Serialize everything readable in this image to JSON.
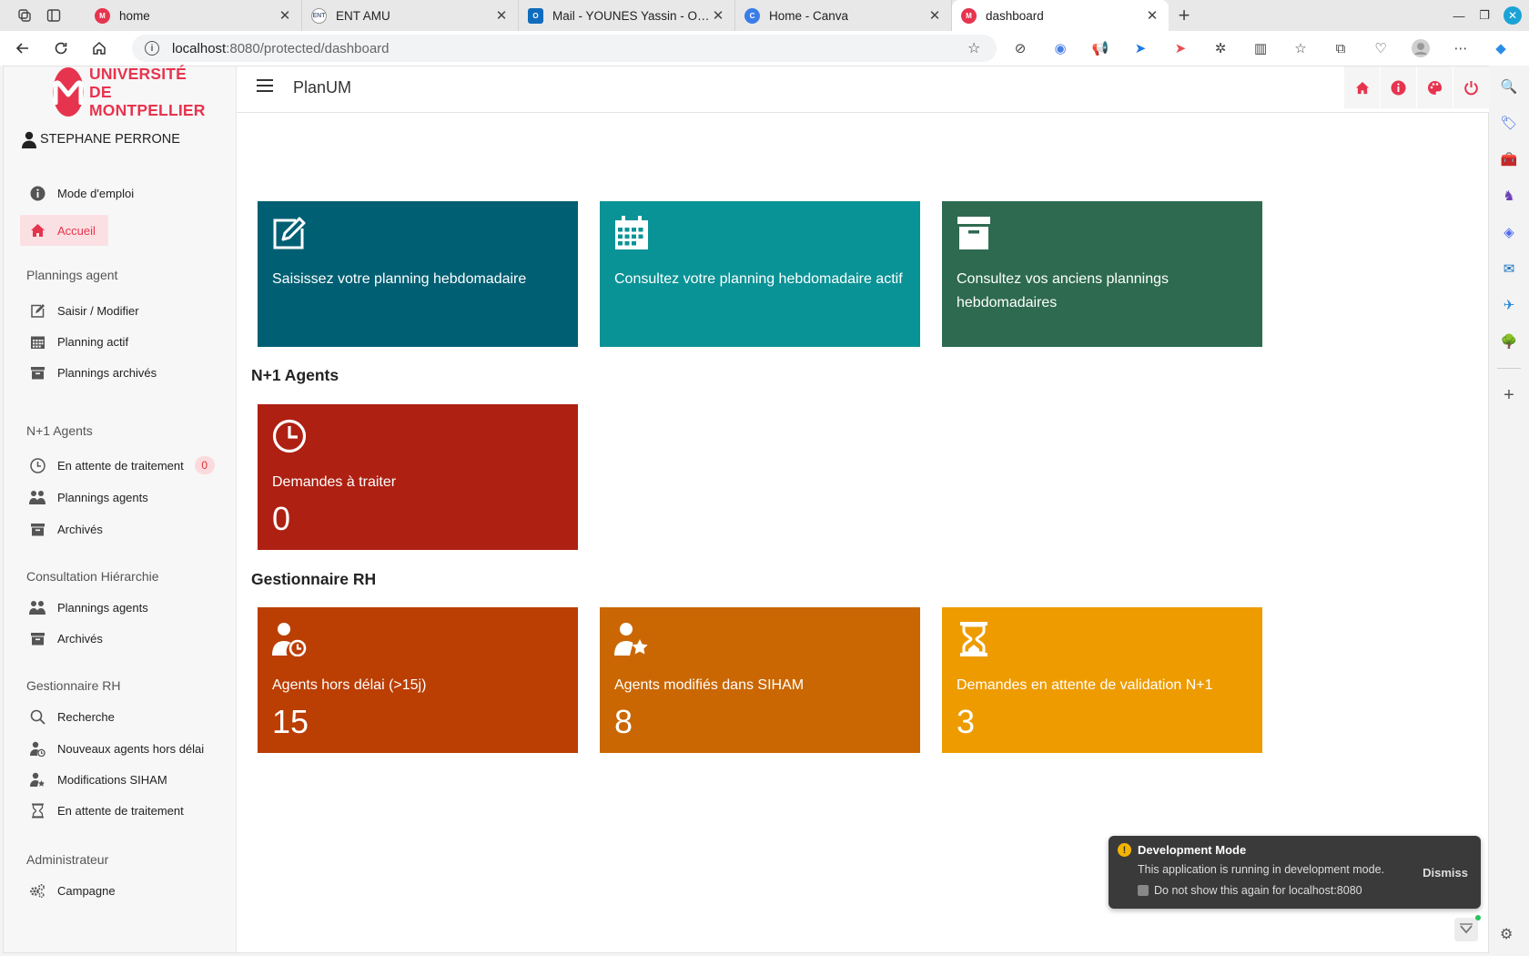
{
  "browser": {
    "tabs": [
      {
        "title": "home",
        "favicon_color": "#e7344e"
      },
      {
        "title": "ENT AMU",
        "favicon_color": "#5a6c8a"
      },
      {
        "title": "Mail - YOUNES Yassin - Outlook",
        "favicon_color": "#0f6cbd"
      },
      {
        "title": "Home - Canva",
        "favicon_color": "#3b7de8"
      },
      {
        "title": "dashboard",
        "favicon_color": "#e7344e"
      }
    ],
    "url_host": "localhost",
    "url_rest": ":8080/protected/dashboard"
  },
  "sidebar": {
    "logo_text_line1": "UNIVERSITÉ DE",
    "logo_text_line2": "MONTPELLIER",
    "user_name": "STEPHANE PERRONE",
    "mode_emploi": "Mode d'emploi",
    "accueil": "Accueil",
    "sections": {
      "plannings_agent": "Plannings agent",
      "n1_agents": "N+1 Agents",
      "consultation": "Consultation Hiérarchie",
      "gestionnaire": "Gestionnaire RH",
      "admin": "Administrateur"
    },
    "items": {
      "saisir": "Saisir / Modifier",
      "planning_actif": "Planning actif",
      "plannings_archives": "Plannings archivés",
      "en_attente": "En attente de traitement",
      "en_attente_badge": "0",
      "plannings_agents_n1": "Plannings agents",
      "archives_n1": "Archivés",
      "plannings_agents_ch": "Plannings agents",
      "archives_ch": "Archivés",
      "recherche": "Recherche",
      "nouveaux_agents": "Nouveaux agents hors délai",
      "modifications_siham": "Modifications SIHAM",
      "en_attente_rh": "En attente de traitement",
      "campagne": "Campagne"
    }
  },
  "header": {
    "title": "PlanUM"
  },
  "main": {
    "cards_top": [
      {
        "label": "Saisissez votre planning hebdomadaire",
        "color": "#005f73"
      },
      {
        "label": "Consultez votre planning hebdomadaire actif",
        "color": "#0a9396"
      },
      {
        "label": "Consultez vos anciens plannings hebdomadaires",
        "color": "#2d6a4f"
      }
    ],
    "section_n1": "N+1 Agents",
    "card_n1": {
      "label": "Demandes à traiter",
      "value": "0",
      "color": "#ae2012"
    },
    "section_rh": "Gestionnaire RH",
    "cards_rh": [
      {
        "label": "Agents hors délai (>15j)",
        "value": "15",
        "color": "#bb3e03"
      },
      {
        "label": "Agents modifiés dans SIHAM",
        "value": "8",
        "color": "#ca6702"
      },
      {
        "label": "Demandes en attente de validation N+1",
        "value": "3",
        "color": "#ee9b00"
      }
    ]
  },
  "toast": {
    "title": "Development Mode",
    "message": "This application is running in development mode.",
    "checkbox_label": "Do not show this again for localhost:8080",
    "dismiss": "Dismiss"
  },
  "colors": {
    "brand": "#e7344e"
  }
}
